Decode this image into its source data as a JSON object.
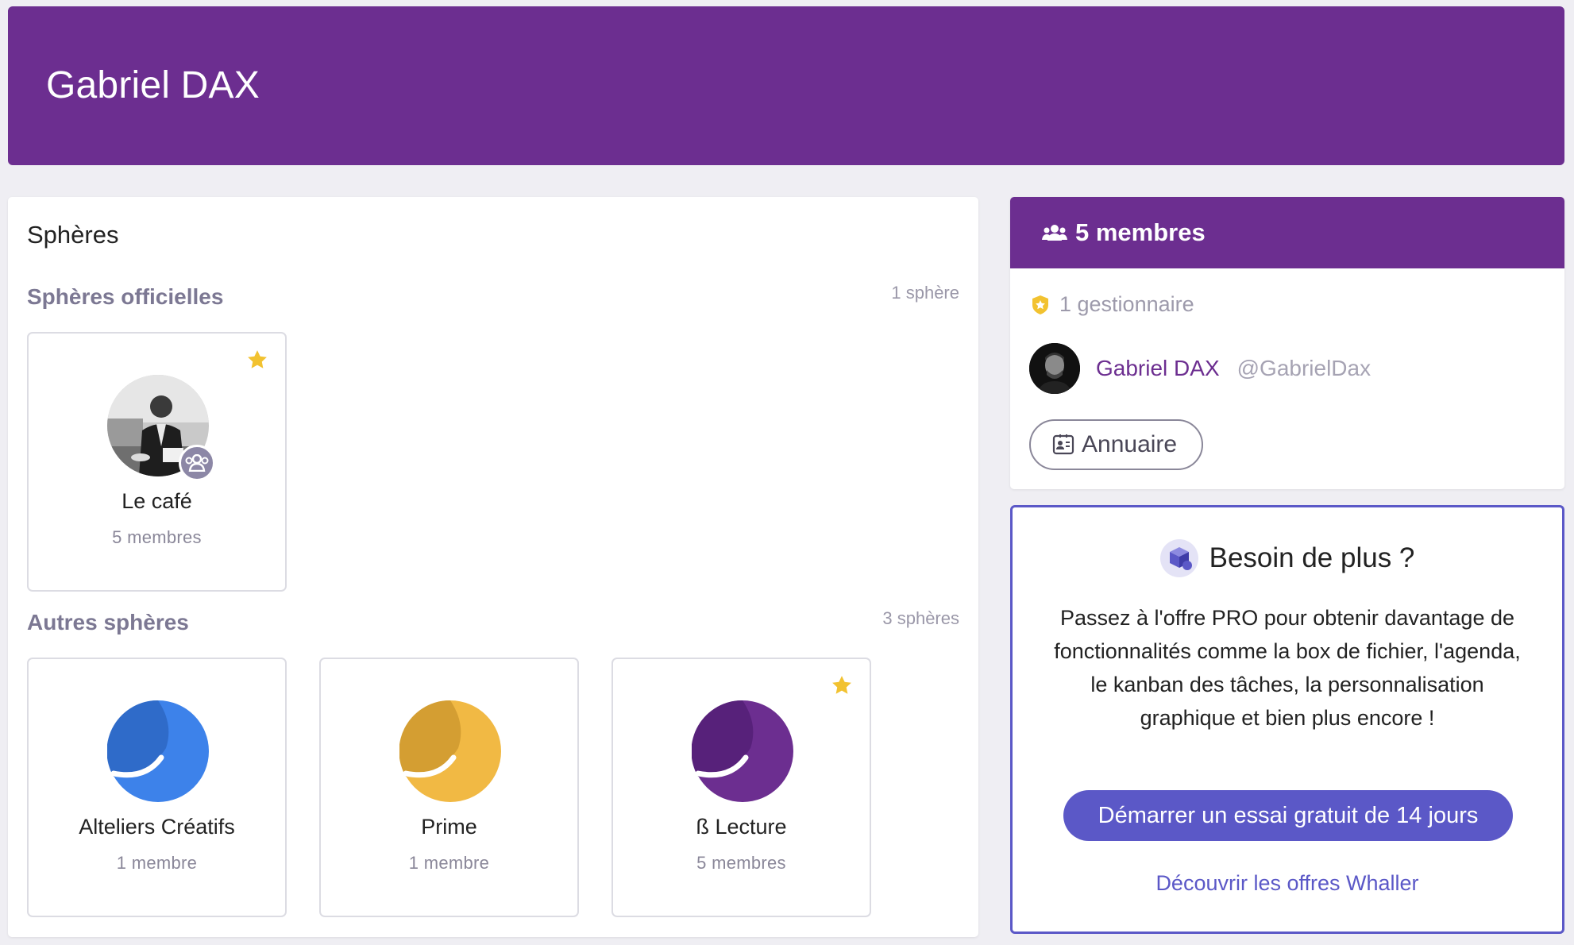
{
  "header": {
    "title": "Gabriel DAX"
  },
  "spheres": {
    "title": "Sphères",
    "official": {
      "title": "Sphères officielles",
      "count": "1 sphère",
      "items": [
        {
          "name": "Le café",
          "members": "5 membres",
          "favorite": true
        }
      ]
    },
    "others": {
      "title": "Autres sphères",
      "count": "3 sphères",
      "items": [
        {
          "name": "Alteliers Créatifs",
          "members": "1 membre",
          "favorite": false,
          "color": "#3d82ea",
          "shade": "#2f6bc9"
        },
        {
          "name": "Prime",
          "members": "1 membre",
          "favorite": false,
          "color": "#f1b944",
          "shade": "#d49e32"
        },
        {
          "name": "ß Lecture",
          "members": "5 membres",
          "favorite": true,
          "color": "#6c2e90",
          "shade": "#57217a"
        }
      ]
    }
  },
  "members_panel": {
    "title": "5 membres",
    "managers_label": "1 gestionnaire",
    "user": {
      "name": "Gabriel DAX",
      "handle": "@GabrielDax"
    },
    "directory_button": "Annuaire"
  },
  "promo": {
    "title": "Besoin de plus ?",
    "text": "Passez à l'offre PRO pour obtenir davantage de fonctionnalités comme la box de fichier, l'agenda, le kanban des tâches, la personnalisation graphique et bien plus encore !",
    "cta": "Démarrer un essai gratuit de 14 jours",
    "link": "Découvrir les offres Whaller"
  },
  "colors": {
    "brand": "#6c2e90",
    "accent": "#5b58c7",
    "star": "#f2c230"
  }
}
